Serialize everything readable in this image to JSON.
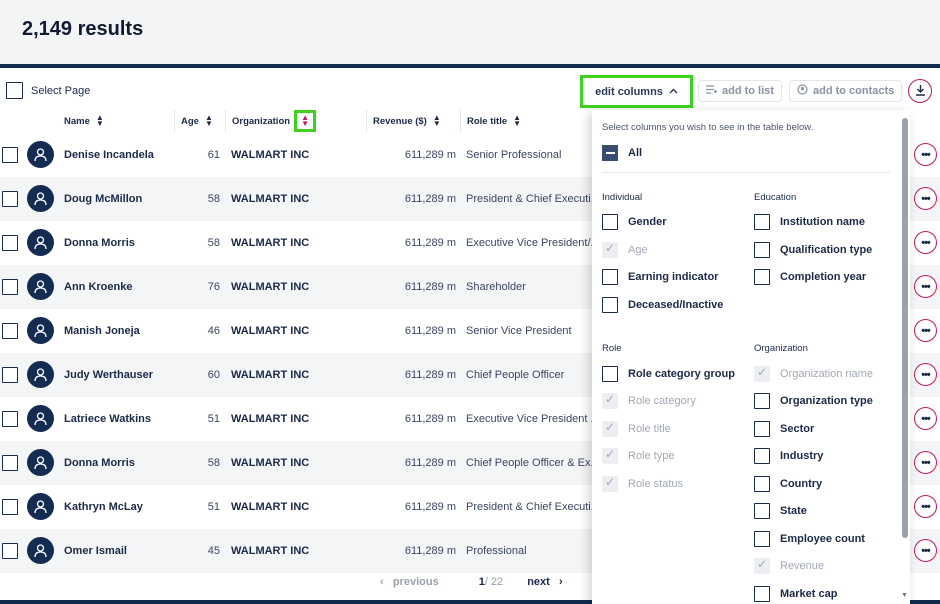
{
  "results_title": "2,149 results",
  "toolbar": {
    "select_page": "Select Page",
    "edit_columns": "edit  columns",
    "add_to_list": "add to list",
    "add_to_contacts": "add to contacts"
  },
  "columns": {
    "name": "Name",
    "age": "Age",
    "organization": "Organization",
    "revenue": "Revenue ($)",
    "role_title": "Role title"
  },
  "rows": [
    {
      "name": "Denise Incandela",
      "age": "61",
      "org": "WALMART INC",
      "revenue": "611,289 m",
      "role": "Senior Professional"
    },
    {
      "name": "Doug McMillon",
      "age": "58",
      "org": "WALMART INC",
      "revenue": "611,289 m",
      "role": "President & Chief Executi..."
    },
    {
      "name": "Donna Morris",
      "age": "58",
      "org": "WALMART INC",
      "revenue": "611,289 m",
      "role": "Executive Vice President/..."
    },
    {
      "name": "Ann Kroenke",
      "age": "76",
      "org": "WALMART INC",
      "revenue": "611,289 m",
      "role": "Shareholder"
    },
    {
      "name": "Manish Joneja",
      "age": "46",
      "org": "WALMART INC",
      "revenue": "611,289 m",
      "role": "Senior Vice President"
    },
    {
      "name": "Judy Werthauser",
      "age": "60",
      "org": "WALMART INC",
      "revenue": "611,289 m",
      "role": "Chief People Officer"
    },
    {
      "name": "Latriece Watkins",
      "age": "51",
      "org": "WALMART INC",
      "revenue": "611,289 m",
      "role": "Executive Vice President ..."
    },
    {
      "name": "Donna Morris",
      "age": "58",
      "org": "WALMART INC",
      "revenue": "611,289 m",
      "role": "Chief People Officer & Ex..."
    },
    {
      "name": "Kathryn McLay",
      "age": "51",
      "org": "WALMART INC",
      "revenue": "611,289 m",
      "role": "President & Chief Executi..."
    },
    {
      "name": "Omer Ismail",
      "age": "45",
      "org": "WALMART INC",
      "revenue": "611,289 m",
      "role": "Professional"
    }
  ],
  "pagination": {
    "previous": "previous",
    "current": "1",
    "total": "/ 22",
    "next": "next"
  },
  "panel": {
    "title": "Select columns you wish to see in the table below.",
    "all_label": "All",
    "individual": {
      "heading": "Individual",
      "gender": "Gender",
      "age": "Age",
      "earning": "Earning indicator",
      "deceased": "Deceased/Inactive"
    },
    "education": {
      "heading": "Education",
      "institution": "Institution name",
      "qualification": "Qualification type",
      "completion": "Completion year"
    },
    "role": {
      "heading": "Role",
      "category_group": "Role category group",
      "category": "Role category",
      "title": "Role title",
      "type": "Role type",
      "status": "Role status"
    },
    "organization": {
      "heading": "Organization",
      "org_name": "Organization name",
      "org_type": "Organization type",
      "sector": "Sector",
      "industry": "Industry",
      "country": "Country",
      "state": "State",
      "employee_count": "Employee count",
      "revenue": "Revenue",
      "market_cap": "Market cap"
    }
  },
  "colors": {
    "navy": "#132a4f",
    "highlight": "#3ed21d",
    "accent": "#c0185d"
  }
}
